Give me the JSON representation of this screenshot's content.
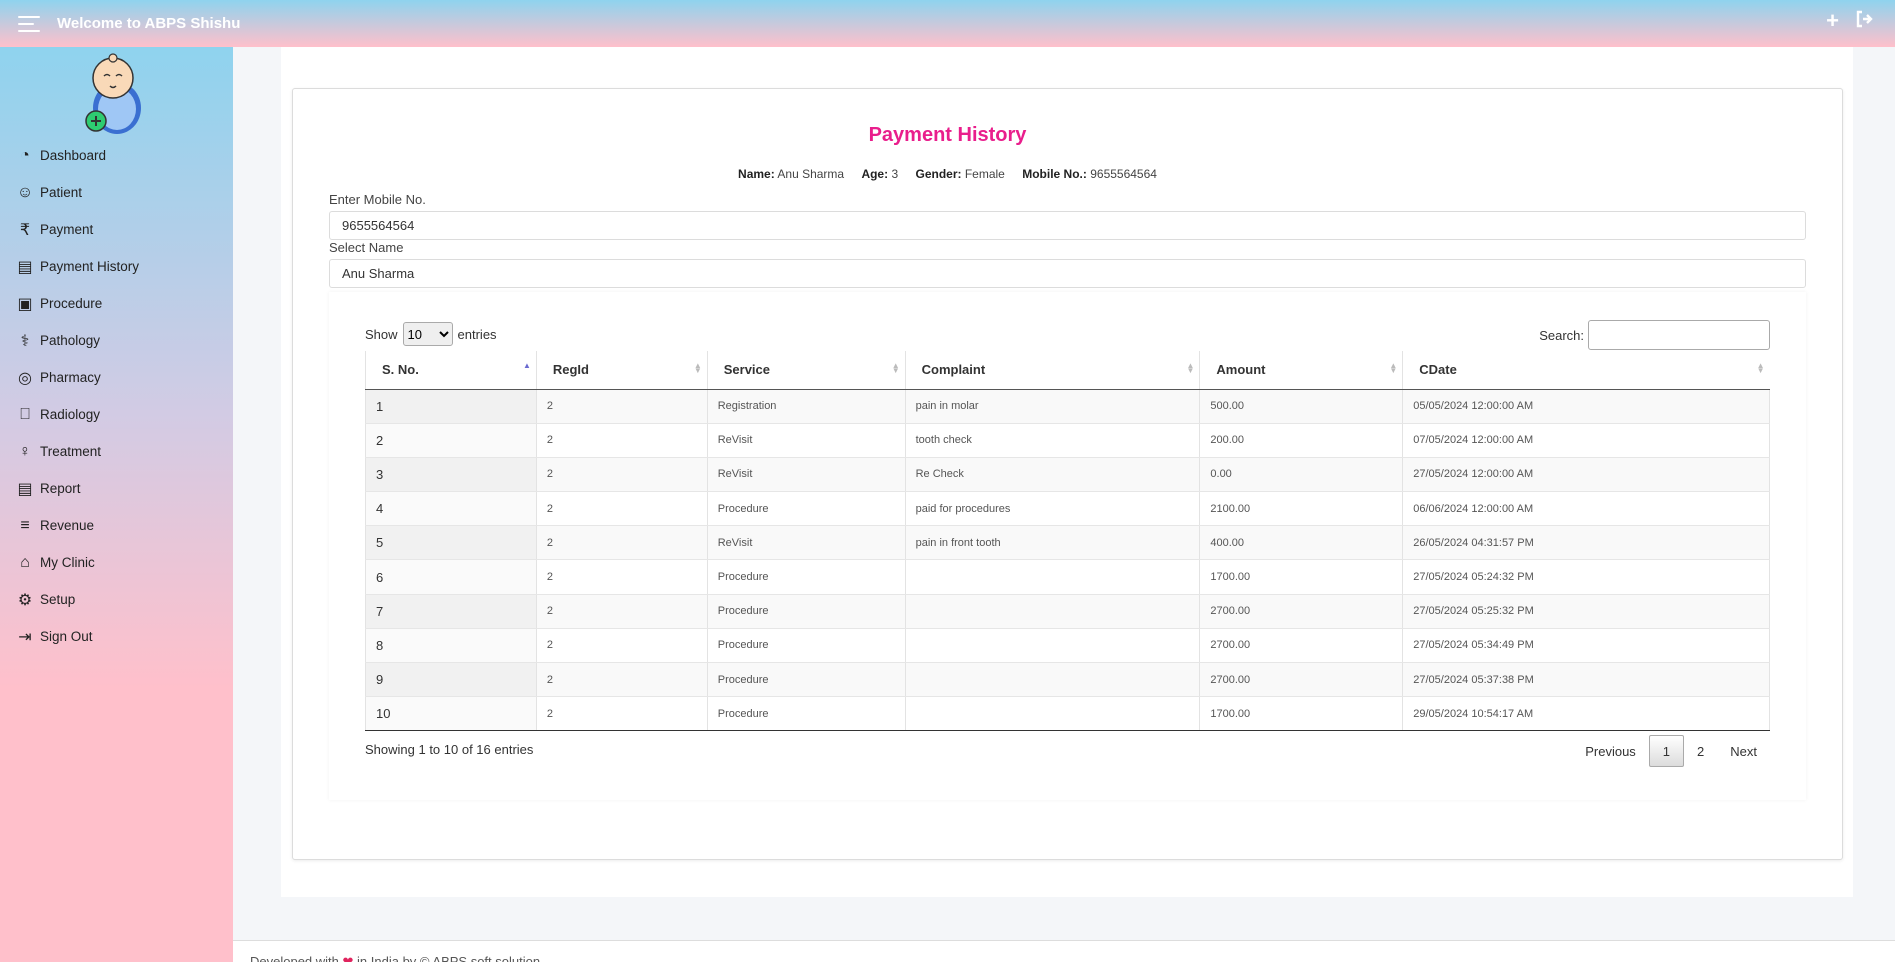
{
  "header": {
    "title": "Welcome to ABPS Shishu",
    "add_icon": "plus-icon",
    "logout_icon": "sign-out-icon"
  },
  "sidebar": {
    "items": [
      {
        "label": "Dashboard",
        "icon": "dashboard-icon"
      },
      {
        "label": "Patient",
        "icon": "patient-icon"
      },
      {
        "label": "Payment",
        "icon": "rupee-icon"
      },
      {
        "label": "Payment History",
        "icon": "file-icon"
      },
      {
        "label": "Procedure",
        "icon": "medkit-icon"
      },
      {
        "label": "Pathology",
        "icon": "microscope-icon"
      },
      {
        "label": "Pharmacy",
        "icon": "pills-icon"
      },
      {
        "label": "Radiology",
        "icon": "xray-icon"
      },
      {
        "label": "Treatment",
        "icon": "stethoscope-icon"
      },
      {
        "label": "Report",
        "icon": "file-icon"
      },
      {
        "label": "Revenue",
        "icon": "coins-icon"
      },
      {
        "label": "My Clinic",
        "icon": "home-icon"
      },
      {
        "label": "Setup",
        "icon": "gear-icon"
      },
      {
        "label": "Sign Out",
        "icon": "sign-out-icon"
      }
    ]
  },
  "page": {
    "title": "Payment History",
    "patient": {
      "name_label": "Name:",
      "name": "Anu Sharma",
      "age_label": "Age:",
      "age": "3",
      "gender_label": "Gender:",
      "gender": "Female",
      "mobile_label": "Mobile No.:",
      "mobile": "9655564564"
    },
    "mobile_field": {
      "label": "Enter Mobile No.",
      "value": "9655564564"
    },
    "name_field": {
      "label": "Select Name",
      "value": "Anu Sharma"
    }
  },
  "table": {
    "show_label": "Show",
    "entries_label": "entries",
    "length_selected": "10",
    "search_label": "Search:",
    "search_value": "",
    "columns": [
      "S. No.",
      "RegId",
      "Service",
      "Complaint",
      "Amount",
      "CDate"
    ],
    "rows": [
      [
        "1",
        "2",
        "Registration",
        "pain in molar",
        "500.00",
        "05/05/2024 12:00:00 AM"
      ],
      [
        "2",
        "2",
        "ReVisit",
        "tooth check",
        "200.00",
        "07/05/2024 12:00:00 AM"
      ],
      [
        "3",
        "2",
        "ReVisit",
        "Re Check",
        "0.00",
        "27/05/2024 12:00:00 AM"
      ],
      [
        "4",
        "2",
        "Procedure",
        "paid for procedures",
        "2100.00",
        "06/06/2024 12:00:00 AM"
      ],
      [
        "5",
        "2",
        "ReVisit",
        "pain in front tooth",
        "400.00",
        "26/05/2024 04:31:57 PM"
      ],
      [
        "6",
        "2",
        "Procedure",
        "",
        "1700.00",
        "27/05/2024 05:24:32 PM"
      ],
      [
        "7",
        "2",
        "Procedure",
        "",
        "2700.00",
        "27/05/2024 05:25:32 PM"
      ],
      [
        "8",
        "2",
        "Procedure",
        "",
        "2700.00",
        "27/05/2024 05:34:49 PM"
      ],
      [
        "9",
        "2",
        "Procedure",
        "",
        "2700.00",
        "27/05/2024 05:37:38 PM"
      ],
      [
        "10",
        "2",
        "Procedure",
        "",
        "1700.00",
        "29/05/2024 10:54:17 AM"
      ]
    ],
    "info": "Showing 1 to 10 of 16 entries",
    "pagination": {
      "previous": "Previous",
      "pages": [
        "1",
        "2"
      ],
      "current": "1",
      "next": "Next"
    }
  },
  "footer": {
    "prefix": "Developed with",
    "suffix": "in India by © ABPS soft solution"
  }
}
